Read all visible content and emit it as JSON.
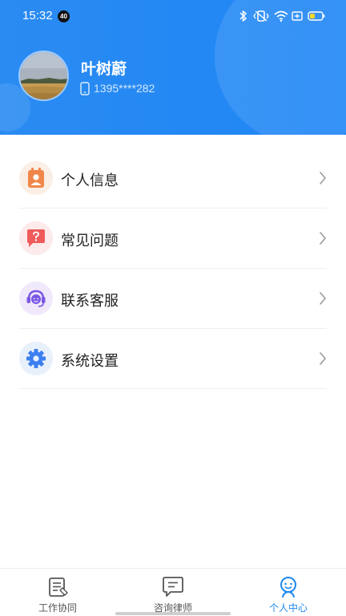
{
  "status_bar": {
    "time": "15:32",
    "notification_count": "40",
    "icons": [
      "bluetooth-icon",
      "vibrate-icon",
      "wifi-icon",
      "battery-saver-icon",
      "battery-icon"
    ]
  },
  "profile": {
    "name": "叶树蔚",
    "phone": "1395****282"
  },
  "menu": {
    "items": [
      {
        "label": "个人信息",
        "icon": "contact-card-icon",
        "color": "#f0874a"
      },
      {
        "label": "常见问题",
        "icon": "question-bubble-icon",
        "color": "#ef5a5a"
      },
      {
        "label": "联系客服",
        "icon": "headset-icon",
        "color": "#7b57e4"
      },
      {
        "label": "系统设置",
        "icon": "gear-icon",
        "color": "#3d7ff0"
      }
    ]
  },
  "bottom_nav": {
    "items": [
      {
        "label": "工作协同",
        "icon": "document-icon",
        "active": false
      },
      {
        "label": "咨询律师",
        "icon": "chat-icon",
        "active": false
      },
      {
        "label": "个人中心",
        "icon": "person-icon",
        "active": true
      }
    ]
  },
  "colors": {
    "header": "#2a8bf2",
    "accent": "#1e88f0"
  }
}
